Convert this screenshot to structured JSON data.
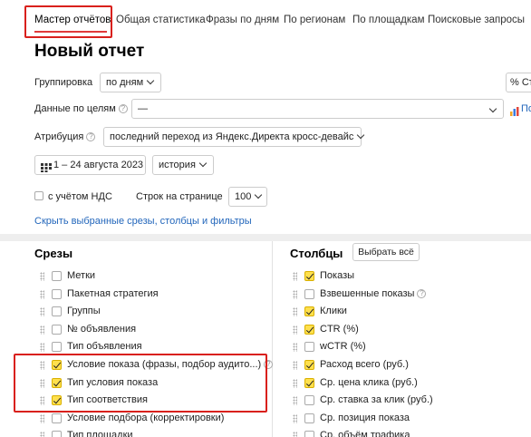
{
  "tabs": [
    "Мастер отчётов",
    "Общая статистика",
    "Фразы по дням",
    "По регионам",
    "По площадкам",
    "Поисковые запросы"
  ],
  "title": "Новый отчет",
  "grouping": {
    "label": "Группировка",
    "value": "по дням"
  },
  "goals": {
    "label": "Данные по целям",
    "value": "—"
  },
  "attribution": {
    "label": "Атрибуция",
    "value": "последний переход из Яндекс.Директа кросс-девайс"
  },
  "date_range": "1 – 24 августа 2023",
  "history": "история",
  "vat_label": "с учётом НДС",
  "rows_label": "Строк на странице",
  "rows_value": "100",
  "hide_link": "Скрыть выбранные срезы, столбцы и фильтры",
  "right_btn_partial": "% Ст",
  "right_link_partial": "По",
  "slices_title": "Срезы",
  "columns_title": "Столбцы",
  "select_all": "Выбрать всё",
  "slices": [
    {
      "label": "Метки",
      "checked": false,
      "help": false
    },
    {
      "label": "Пакетная стратегия",
      "checked": false,
      "help": false
    },
    {
      "label": "Группы",
      "checked": false,
      "help": false
    },
    {
      "label": "№ объявления",
      "checked": false,
      "help": false
    },
    {
      "label": "Тип объявления",
      "checked": false,
      "help": false
    },
    {
      "label": "Условие показа (фразы, подбор аудито...)",
      "checked": true,
      "help": true
    },
    {
      "label": "Тип условия показа",
      "checked": true,
      "help": false
    },
    {
      "label": "Тип соответствия",
      "checked": true,
      "help": false
    },
    {
      "label": "Условие подбора (корректировки)",
      "checked": false,
      "help": false
    },
    {
      "label": "Тип площадки",
      "checked": false,
      "help": false
    }
  ],
  "columns": [
    {
      "label": "Показы",
      "checked": true,
      "help": false
    },
    {
      "label": "Взвешенные показы",
      "checked": false,
      "help": true
    },
    {
      "label": "Клики",
      "checked": true,
      "help": false
    },
    {
      "label": "CTR (%)",
      "checked": true,
      "help": false
    },
    {
      "label": "wCTR (%)",
      "checked": false,
      "help": false
    },
    {
      "label": "Расход всего (руб.)",
      "checked": true,
      "help": false
    },
    {
      "label": "Ср. цена клика (руб.)",
      "checked": true,
      "help": false
    },
    {
      "label": "Ср. ставка за клик (руб.)",
      "checked": false,
      "help": false
    },
    {
      "label": "Ср. позиция показа",
      "checked": false,
      "help": false
    },
    {
      "label": "Ср. объём трафика",
      "checked": false,
      "help": false
    }
  ]
}
